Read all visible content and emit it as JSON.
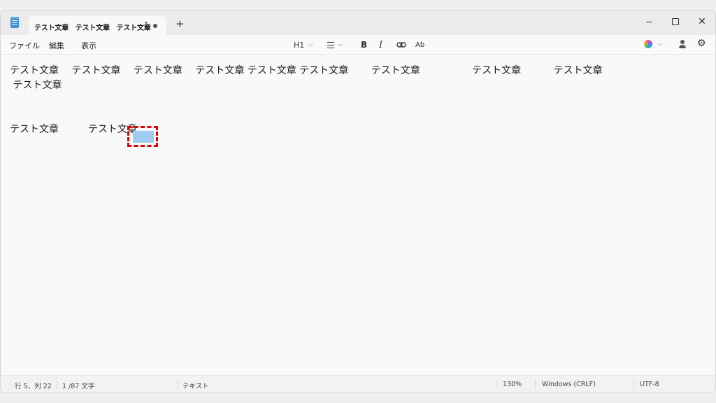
{
  "titlebar": {
    "tab_title": "テスト文章　テスト文章　テスト文章",
    "more_glyph": "⋮",
    "new_tab_glyph": "+",
    "minimize_glyph": "",
    "maximize_glyph": "",
    "close_glyph": "✕"
  },
  "menu": {
    "file": "ファイル",
    "edit": "編集",
    "view": "表示"
  },
  "format": {
    "heading": "H1",
    "chevron": "⌵",
    "bold": "B",
    "italic": "I",
    "link": "⊖",
    "spellcheck": "Ab"
  },
  "tools": {
    "settings_glyph": "⚙"
  },
  "editor": {
    "line1": "テスト文章　 テスト文章　 テスト文章　 テスト文章 テスト文章 テスト文章　　 テスト文章　　　　　 テスト文章　　　 テスト文章",
    "line2": " テスト文章",
    "line3": "テスト文章　　　テスト文章"
  },
  "status": {
    "position": "行 5、列 22",
    "chars": "1 /87 文字",
    "format": "テキスト",
    "zoom": "130%",
    "line_ending": "Windows (CRLF)",
    "encoding": "UTF-8"
  },
  "colors": {
    "selection": "#9ecbef",
    "highlight_border": "#e00000",
    "accent": "#3a8fd6"
  }
}
